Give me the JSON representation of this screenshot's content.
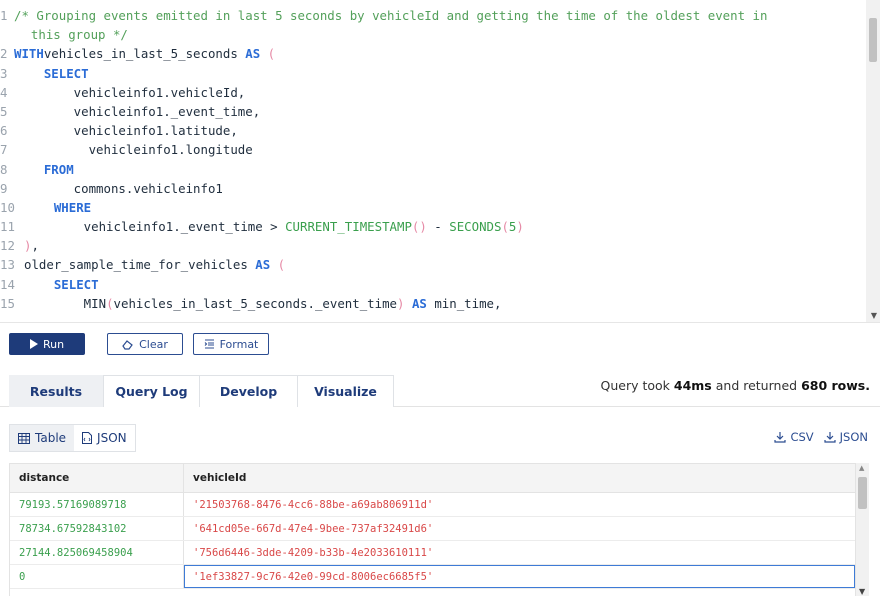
{
  "editor": {
    "lines": [
      {
        "n": "1",
        "segs": [
          [
            "cm",
            "/* Grouping events emitted in last 5 seconds by vehicleId and getting the time of the oldest event in"
          ]
        ]
      },
      {
        "n": "",
        "segs": [
          [
            "cm",
            "  this group */"
          ]
        ]
      },
      {
        "n": "2",
        "segs": [
          [
            "kw",
            "WITH"
          ],
          [
            "",
            "vehicles_in_last_5_seconds "
          ],
          [
            "kw",
            "AS"
          ],
          [
            "pn",
            " ("
          ]
        ]
      },
      {
        "n": "3",
        "segs": [
          [
            "",
            "    "
          ],
          [
            "kw",
            "SELECT"
          ]
        ]
      },
      {
        "n": "4",
        "segs": [
          [
            "",
            "        vehicleinfo1.vehicleId,"
          ]
        ]
      },
      {
        "n": "5",
        "segs": [
          [
            "",
            "        vehicleinfo1._event_time,"
          ]
        ]
      },
      {
        "n": "6",
        "segs": [
          [
            "",
            "        vehicleinfo1.latitude,"
          ]
        ]
      },
      {
        "n": "7",
        "segs": [
          [
            "",
            "          vehicleinfo1.longitude"
          ]
        ]
      },
      {
        "n": "8",
        "segs": [
          [
            "",
            "    "
          ],
          [
            "kw",
            "FROM"
          ]
        ]
      },
      {
        "n": "9",
        "segs": [
          [
            "",
            "        commons.vehicleinfo1"
          ]
        ]
      },
      {
        "n": "10",
        "segs": [
          [
            "",
            "    "
          ],
          [
            "kw",
            "WHERE"
          ]
        ]
      },
      {
        "n": "11",
        "segs": [
          [
            "",
            "        vehicleinfo1._event_time > "
          ],
          [
            "fn",
            "CURRENT_TIMESTAMP"
          ],
          [
            "pn",
            "()"
          ],
          [
            "",
            " - "
          ],
          [
            "fn",
            "SECONDS"
          ],
          [
            "pn",
            "("
          ],
          [
            "num",
            "5"
          ],
          [
            "pn",
            ")"
          ]
        ]
      },
      {
        "n": "12",
        "segs": [
          [
            "pn",
            ")"
          ],
          [
            "",
            ","
          ]
        ]
      },
      {
        "n": "13",
        "segs": [
          [
            "",
            "older_sample_time_for_vehicles "
          ],
          [
            "kw",
            "AS"
          ],
          [
            "pn",
            " ("
          ]
        ]
      },
      {
        "n": "14",
        "segs": [
          [
            "",
            "    "
          ],
          [
            "kw",
            "SELECT"
          ]
        ]
      },
      {
        "n": "15",
        "segs": [
          [
            "",
            "        MIN"
          ],
          [
            "pn",
            "("
          ],
          [
            "",
            "vehicles_in_last_5_seconds._event_time"
          ],
          [
            "pn",
            ")"
          ],
          [
            "",
            " "
          ],
          [
            "kw",
            "AS"
          ],
          [
            "",
            " min_time,"
          ]
        ]
      }
    ]
  },
  "toolbar": {
    "run_label": "Run",
    "clear_label": "Clear",
    "format_label": "Format"
  },
  "tabs": [
    "Results",
    "Query Log",
    "Develop",
    "Visualize"
  ],
  "stats": {
    "prefix": "Query took ",
    "duration": "44ms",
    "middle": " and returned ",
    "rows": "680 rows."
  },
  "view_tabs": {
    "table_label": "Table",
    "json_label": "JSON"
  },
  "export": {
    "csv_label": "CSV",
    "json_label": "JSON"
  },
  "table": {
    "columns": [
      "distance",
      "vehicleId"
    ],
    "rows": [
      [
        "79193.57169089718",
        "'21503768-8476-4cc6-88be-a69ab806911d'"
      ],
      [
        "78734.67592843102",
        "'641cd05e-667d-47e4-9bee-737af32491d6'"
      ],
      [
        "27144.825069458904",
        "'756d6446-3dde-4209-b33b-4e2033610111'"
      ],
      [
        "0",
        "'1ef33827-9c76-42e0-99cd-8006ec6685f5'"
      ]
    ]
  },
  "colors": {
    "accent": "#1e3b7a",
    "number": "#3a9f4d",
    "string": "#d94848"
  }
}
